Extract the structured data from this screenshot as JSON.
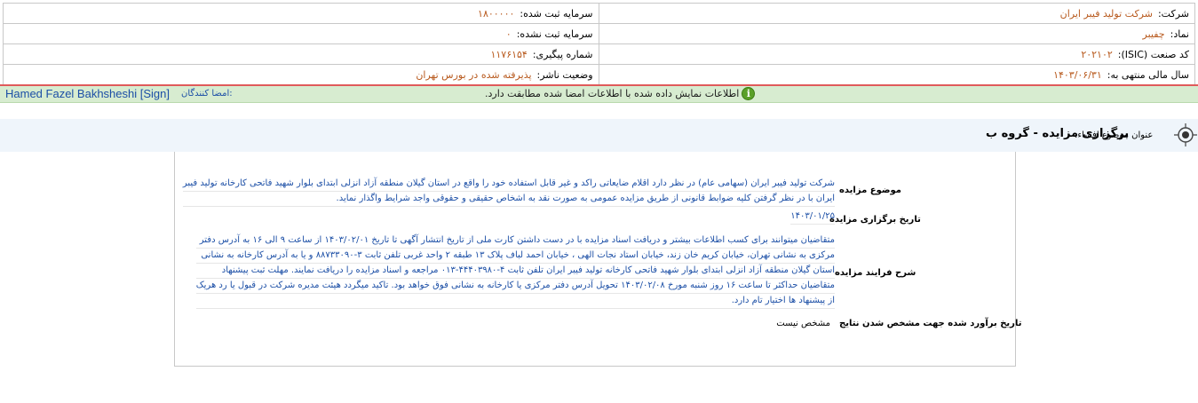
{
  "company_info": {
    "company_label": "شرکت:",
    "company_value": "شرکت تولید فیبر ایران",
    "capital_registered_label": "سرمایه ثبت شده:",
    "capital_registered_value": "۱۸۰۰۰۰۰",
    "symbol_label": "نماد:",
    "symbol_value": "چفیبر",
    "capital_unregistered_label": "سرمایه ثبت نشده:",
    "capital_unregistered_value": "۰",
    "isic_label": "کد صنعت (ISIC):",
    "isic_value": "۲۰۲۱۰۲",
    "tracking_label": "شماره پیگیری:",
    "tracking_value": "۱۱۷۶۱۵۴",
    "fiscal_year_label": "سال مالی منتهی به:",
    "fiscal_year_value": "۱۴۰۳/۰۶/۳۱",
    "publisher_status_label": "وضعیت ناشر:",
    "publisher_status_value": "پذیرفته شده در بورس تهران"
  },
  "signature": {
    "signer_name": "Hamed Fazel Bakhsheshi [Sign]",
    "signers_label": "امضا کنندگان:",
    "verify_message": "اطلاعات نمایش داده شده با اطلاعات امضا شده مطابقت دارد."
  },
  "title": {
    "label": "عنوان موضوع افشاء:",
    "text": "برگزاری مزایده - گروه ب"
  },
  "details": {
    "subject_label": "موضوع مزایده",
    "subject_lines": [
      "شرکت تولید فیبر ایران (سهامی عام) در نظر دارد اقلام ضایعاتی راکد و غیر قابل استفاده خود را واقع در استان گیلان منطقه آزاد انزلی ابتدای بلوار شهید فاتحی کارخانه تولید فیبر",
      "ایران با در نظر گرفتن کلیه ضوابط قانونی از طریق مزایده عمومی به صورت نقد به اشخاص حقیقی و حقوقی واجد شرایط واگذار نماید."
    ],
    "date_label": "تاریخ برگزاری مزایده",
    "date_value": "۱۴۰۳/۰۱/۲۵",
    "process_label": "شرح فرایند مزایده",
    "process_lines": [
      "متقاضیان میتوانند برای کسب اطلاعات بیشتر و دریافت اسناد مزایده با در دست داشتن کارت ملی از تاریخ انتشار آگهی تا تاریخ ۱۴۰۳/۰۲/۰۱ از ساعت ۹ الی ۱۶ به آدرس دفتر",
      "مرکزی به نشانی تهران، خیابان کریم خان زند، خیابان استاد نجات الهی ، خیابان احمد لباف پلاک ۱۳ طبقه ۲ واحد غربی تلفن ثابت ۳-۸۸۷۳۳۰۹۰ و یا به آدرس کارخانه به نشانی",
      "استان گیلان منطقه آزاد انزلی ابتدای بلوار شهید فاتحی کارخانه تولید فیبر ایران تلفن ثابت ۴-۴۴۴۰۳۹۸۰-۰۱۳ مراجعه و اسناد مزایده را دریافت نمایند. مهلت ثبت پیشنهاد",
      "متقاضیان حداکثر تا ساعت ۱۶ روز شنبه مورخ ۱۴۰۳/۰۲/۰۸ تحویل آدرس دفتر مرکزی یا کارخانه به نشانی فوق خواهد بود. تاکید میگردد هیئت مدیره شرکت در قبول یا رد هریک",
      "از پیشنهاد ها اختیار تام دارد."
    ],
    "results_label": "تاریخ برآورد شده جهت مشخص شدن نتایج",
    "results_value": "مشخص نیست"
  },
  "colors": {
    "value_brown": "#b85a1e",
    "value_blue": "#1c4fa6",
    "sign_bar_green": "#d7ecd0",
    "separator_red": "#e05a5a"
  }
}
